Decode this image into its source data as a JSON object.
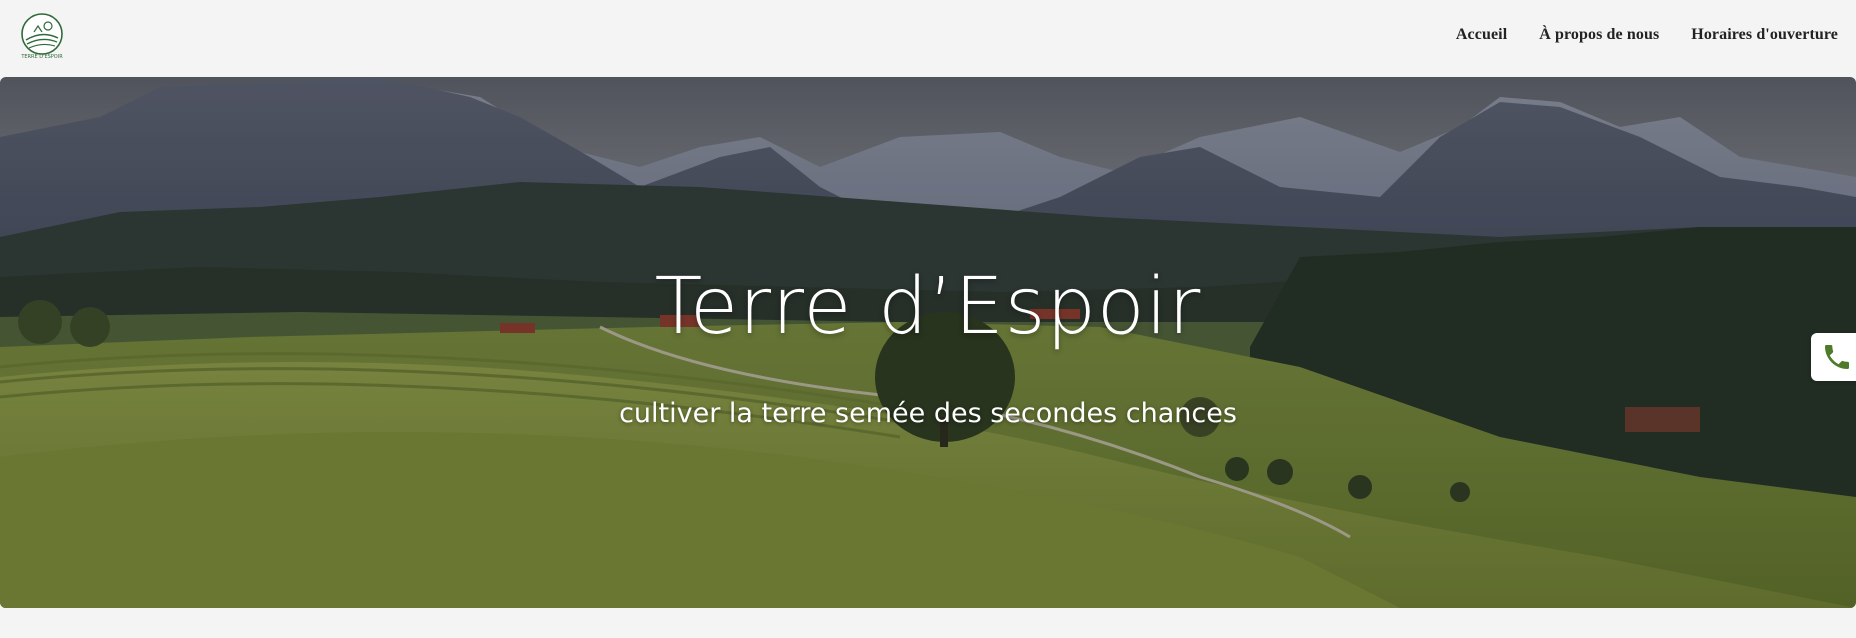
{
  "brand": {
    "logo_text": "TERRE D'ESPOIR"
  },
  "nav": {
    "items": [
      {
        "label": "Accueil"
      },
      {
        "label": "À propos de nous"
      },
      {
        "label": "Horaires d'ouverture"
      }
    ]
  },
  "hero": {
    "title": "Terre d’Espoir",
    "subtitle": "cultiver la terre semée des secondes chances"
  },
  "colors": {
    "brand_green": "#2f6b3a",
    "phone_icon": "#4e7a2a"
  },
  "icons": {
    "phone": "phone-icon",
    "logo": "logo-icon"
  }
}
